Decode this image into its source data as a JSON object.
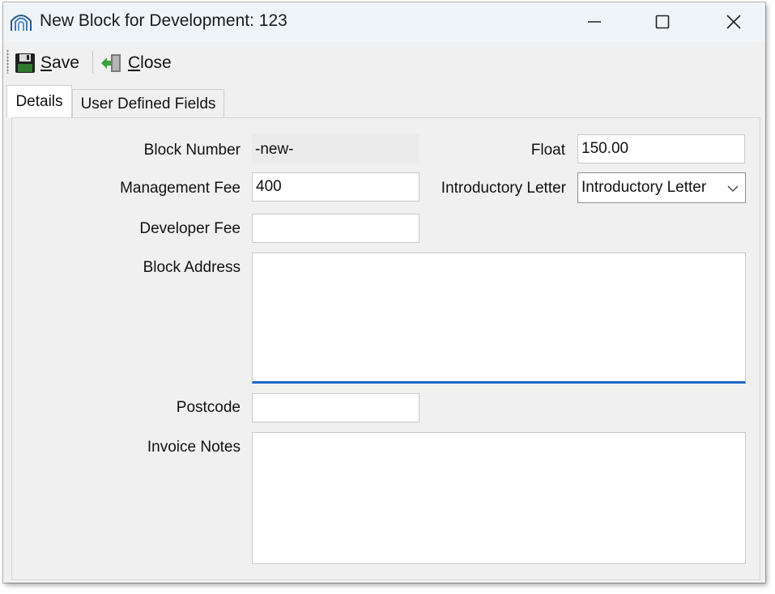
{
  "window": {
    "title": "New Block for Development: 123",
    "icon": "arch-app-icon",
    "controls": [
      "minimize-icon",
      "maximize-icon",
      "close-icon"
    ]
  },
  "toolbar": {
    "save_mnemonic": "S",
    "save_rest": "ave",
    "close_mnemonic": "C",
    "close_rest": "lose"
  },
  "tabs": [
    {
      "label": "Details",
      "active": true
    },
    {
      "label": "User Defined Fields",
      "active": false
    }
  ],
  "form": {
    "block_number": {
      "label": "Block Number",
      "value": "-new-"
    },
    "float": {
      "label": "Float",
      "value": "150.00"
    },
    "management_fee": {
      "label": "Management Fee",
      "value": "400"
    },
    "introductory_letter": {
      "label": "Introductory Letter",
      "value": "Introductory Letter"
    },
    "developer_fee": {
      "label": "Developer Fee",
      "value": ""
    },
    "block_address": {
      "label": "Block Address",
      "value": ""
    },
    "postcode": {
      "label": "Postcode",
      "value": ""
    },
    "invoice_notes": {
      "label": "Invoice Notes",
      "value": ""
    }
  },
  "colors": {
    "titlebar": "#eff4f9",
    "window": "#f0f0f0",
    "focus_accent": "#1b6ac9"
  }
}
